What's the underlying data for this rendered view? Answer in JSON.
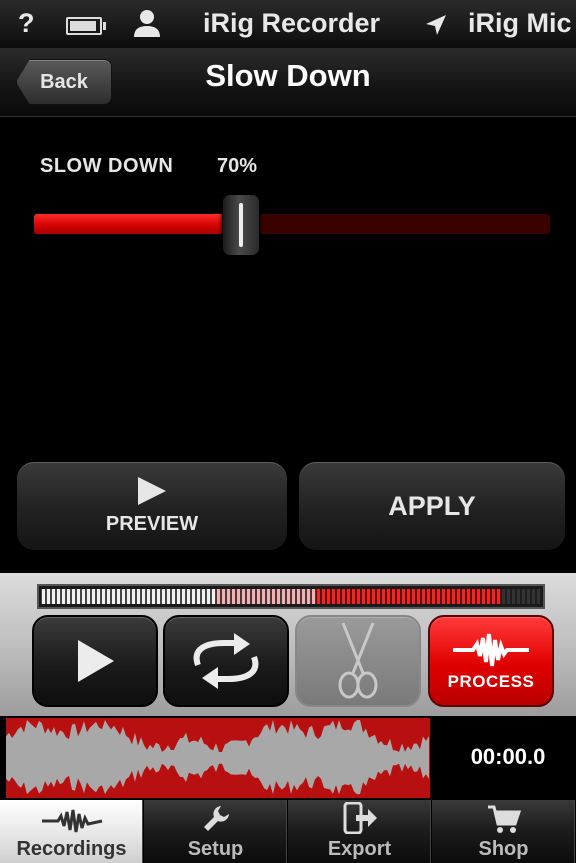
{
  "status_bar": {
    "help": "?",
    "app_name": "iRig Recorder",
    "input_name": "iRig Mic"
  },
  "nav": {
    "back_label": "Back",
    "title": "Slow Down"
  },
  "slider": {
    "label": "SLOW DOWN",
    "value_text": "70%",
    "value_fraction": 0.4
  },
  "actions": {
    "preview_label": "PREVIEW",
    "apply_label": "APPLY"
  },
  "meter": {
    "level_fraction": 0.92
  },
  "transport": {
    "play_icon": "play-icon",
    "loop_icon": "loop-icon",
    "cut_icon": "scissors-icon",
    "process_label": "PROCESS"
  },
  "waveform": {
    "time": "00:00.0"
  },
  "tabs": [
    {
      "label": "Recordings",
      "icon": "waveform-icon",
      "active": true
    },
    {
      "label": "Setup",
      "icon": "wrench-icon",
      "active": false
    },
    {
      "label": "Export",
      "icon": "export-icon",
      "active": false
    },
    {
      "label": "Shop",
      "icon": "cart-icon",
      "active": false
    }
  ],
  "colors": {
    "accent_red": "#e00000",
    "waveform_bg": "#b81010",
    "waveform_fg": "#a8a8a8"
  }
}
